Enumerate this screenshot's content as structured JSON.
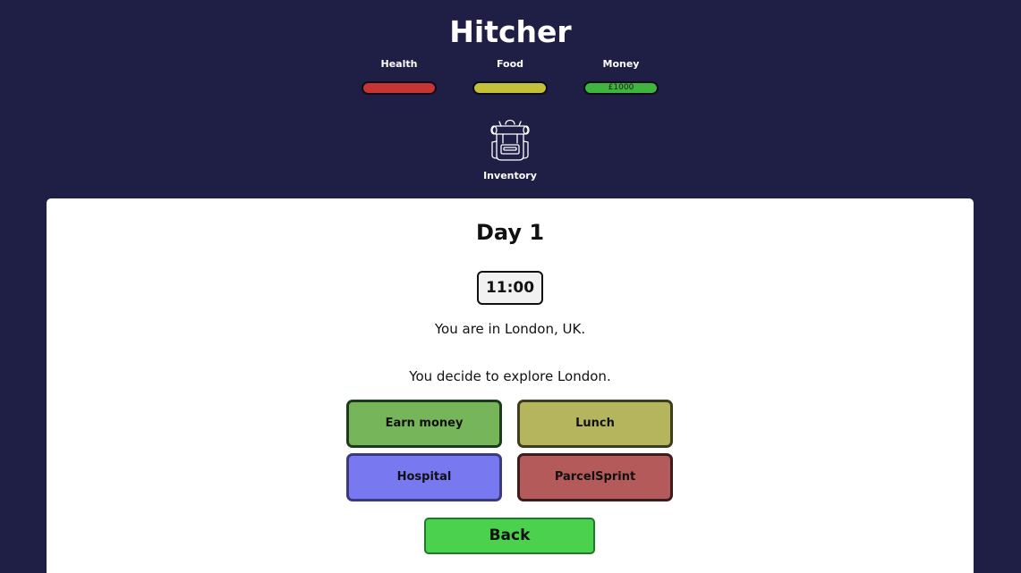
{
  "header": {
    "title": "Hitcher"
  },
  "stats": {
    "health": {
      "label": "Health",
      "color": "#c63434",
      "level": 1.0
    },
    "food": {
      "label": "Food",
      "color": "#c3c13a",
      "level": 1.0
    },
    "money": {
      "label": "Money",
      "color": "#3fb53f",
      "value": "£1000",
      "level": 1.0
    }
  },
  "inventory": {
    "label": "Inventory",
    "icon": "backpack-icon"
  },
  "main": {
    "day_title": "Day 1",
    "time": "11:00",
    "location_text": "You are in London, UK.",
    "decision_text": "You decide to explore London.",
    "actions": [
      {
        "label": "Earn money",
        "color": "#77b55a",
        "border": "#1c3b1c"
      },
      {
        "label": "Lunch",
        "color": "#b5b55e",
        "border": "#3d3d20"
      },
      {
        "label": "Hospital",
        "color": "#7878f0",
        "border": "#3a3a80"
      },
      {
        "label": "ParcelSprint",
        "color": "#b55a5a",
        "border": "#3d1c1c"
      }
    ],
    "back_label": "Back"
  }
}
